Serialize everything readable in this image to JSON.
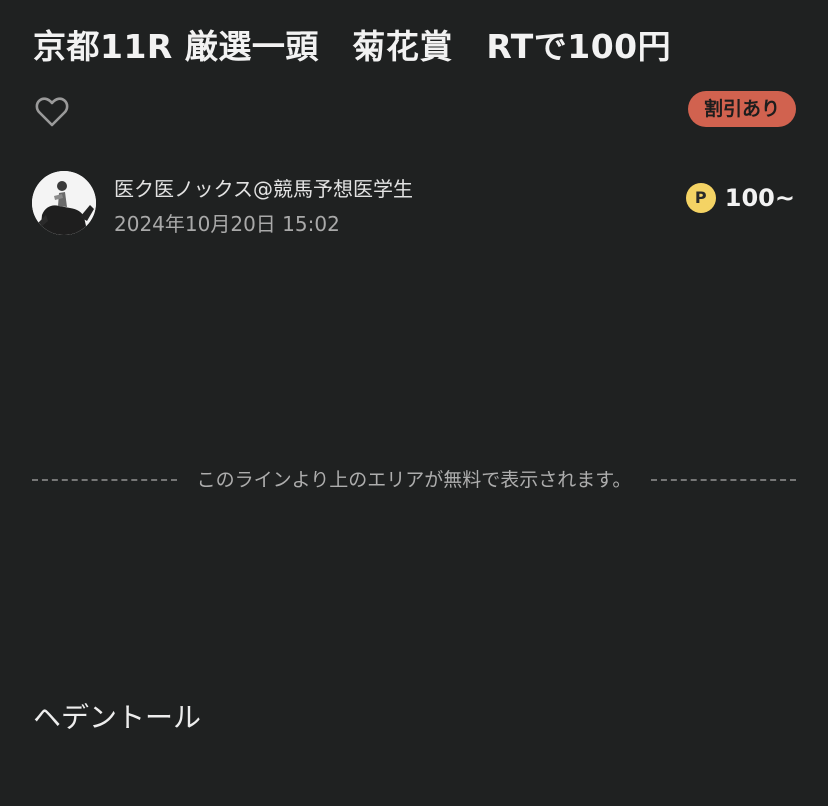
{
  "article": {
    "title": "京都11R 厳選一頭　菊花賞　RTで100円",
    "discount_badge": "割引あり",
    "author_name": "医ク医ノックス@競馬予想医学生",
    "date": "2024年10月20日 15:02",
    "price": {
      "coin_letter": "P",
      "value": "100~"
    },
    "free_area_notice": "このラインより上のエリアが無料で表示されます。",
    "body_text": "ヘデントール"
  },
  "icons": {
    "like": "heart-icon",
    "price": "point-coin-icon"
  },
  "colors": {
    "background": "#1f2121",
    "badge": "#d1624f",
    "coin": "#f4d364"
  }
}
